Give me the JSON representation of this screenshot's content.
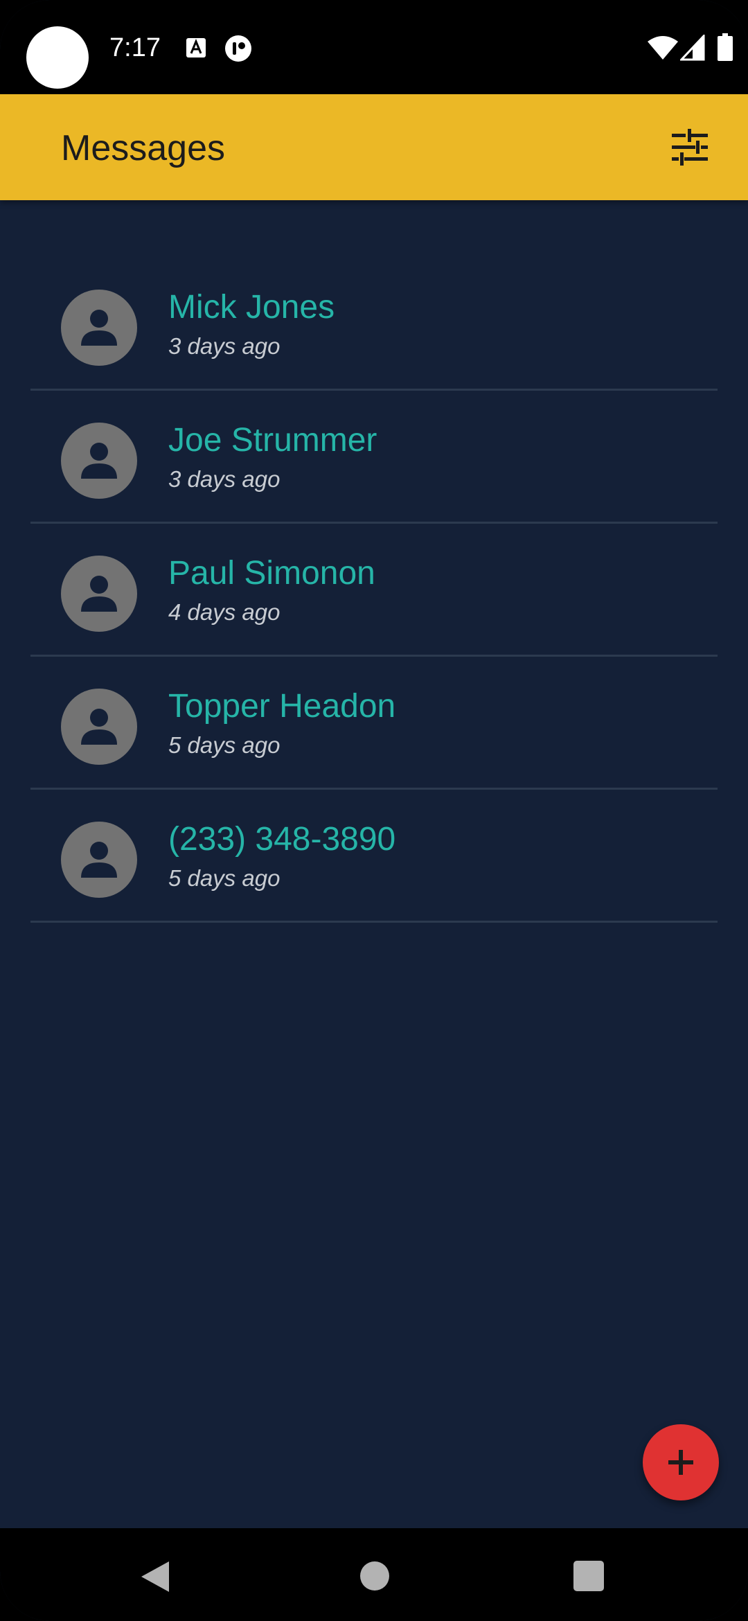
{
  "status_bar": {
    "time": "7:17",
    "icons": [
      "text-recognition-icon",
      "notification-app-icon",
      "wifi-icon",
      "cell-signal-icon",
      "battery-icon"
    ]
  },
  "app_bar": {
    "title": "Messages",
    "filter_icon": "tune-sliders-icon"
  },
  "conversations": [
    {
      "name": "Mick Jones",
      "time": "3 days ago"
    },
    {
      "name": "Joe Strummer",
      "time": "3 days ago"
    },
    {
      "name": "Paul Simonon",
      "time": "4 days ago"
    },
    {
      "name": "Topper Headon",
      "time": "5 days ago"
    },
    {
      "name": "(233) 348-3890",
      "time": "5 days ago"
    }
  ],
  "fab": {
    "icon": "plus-icon"
  },
  "nav_bar": {
    "icons": [
      "back-icon",
      "home-icon",
      "recents-icon"
    ]
  },
  "colors": {
    "app_bar": "#ebb826",
    "background": "#142037",
    "name_text": "#26b5a8",
    "fab": "#e03232",
    "avatar": "#737373"
  }
}
